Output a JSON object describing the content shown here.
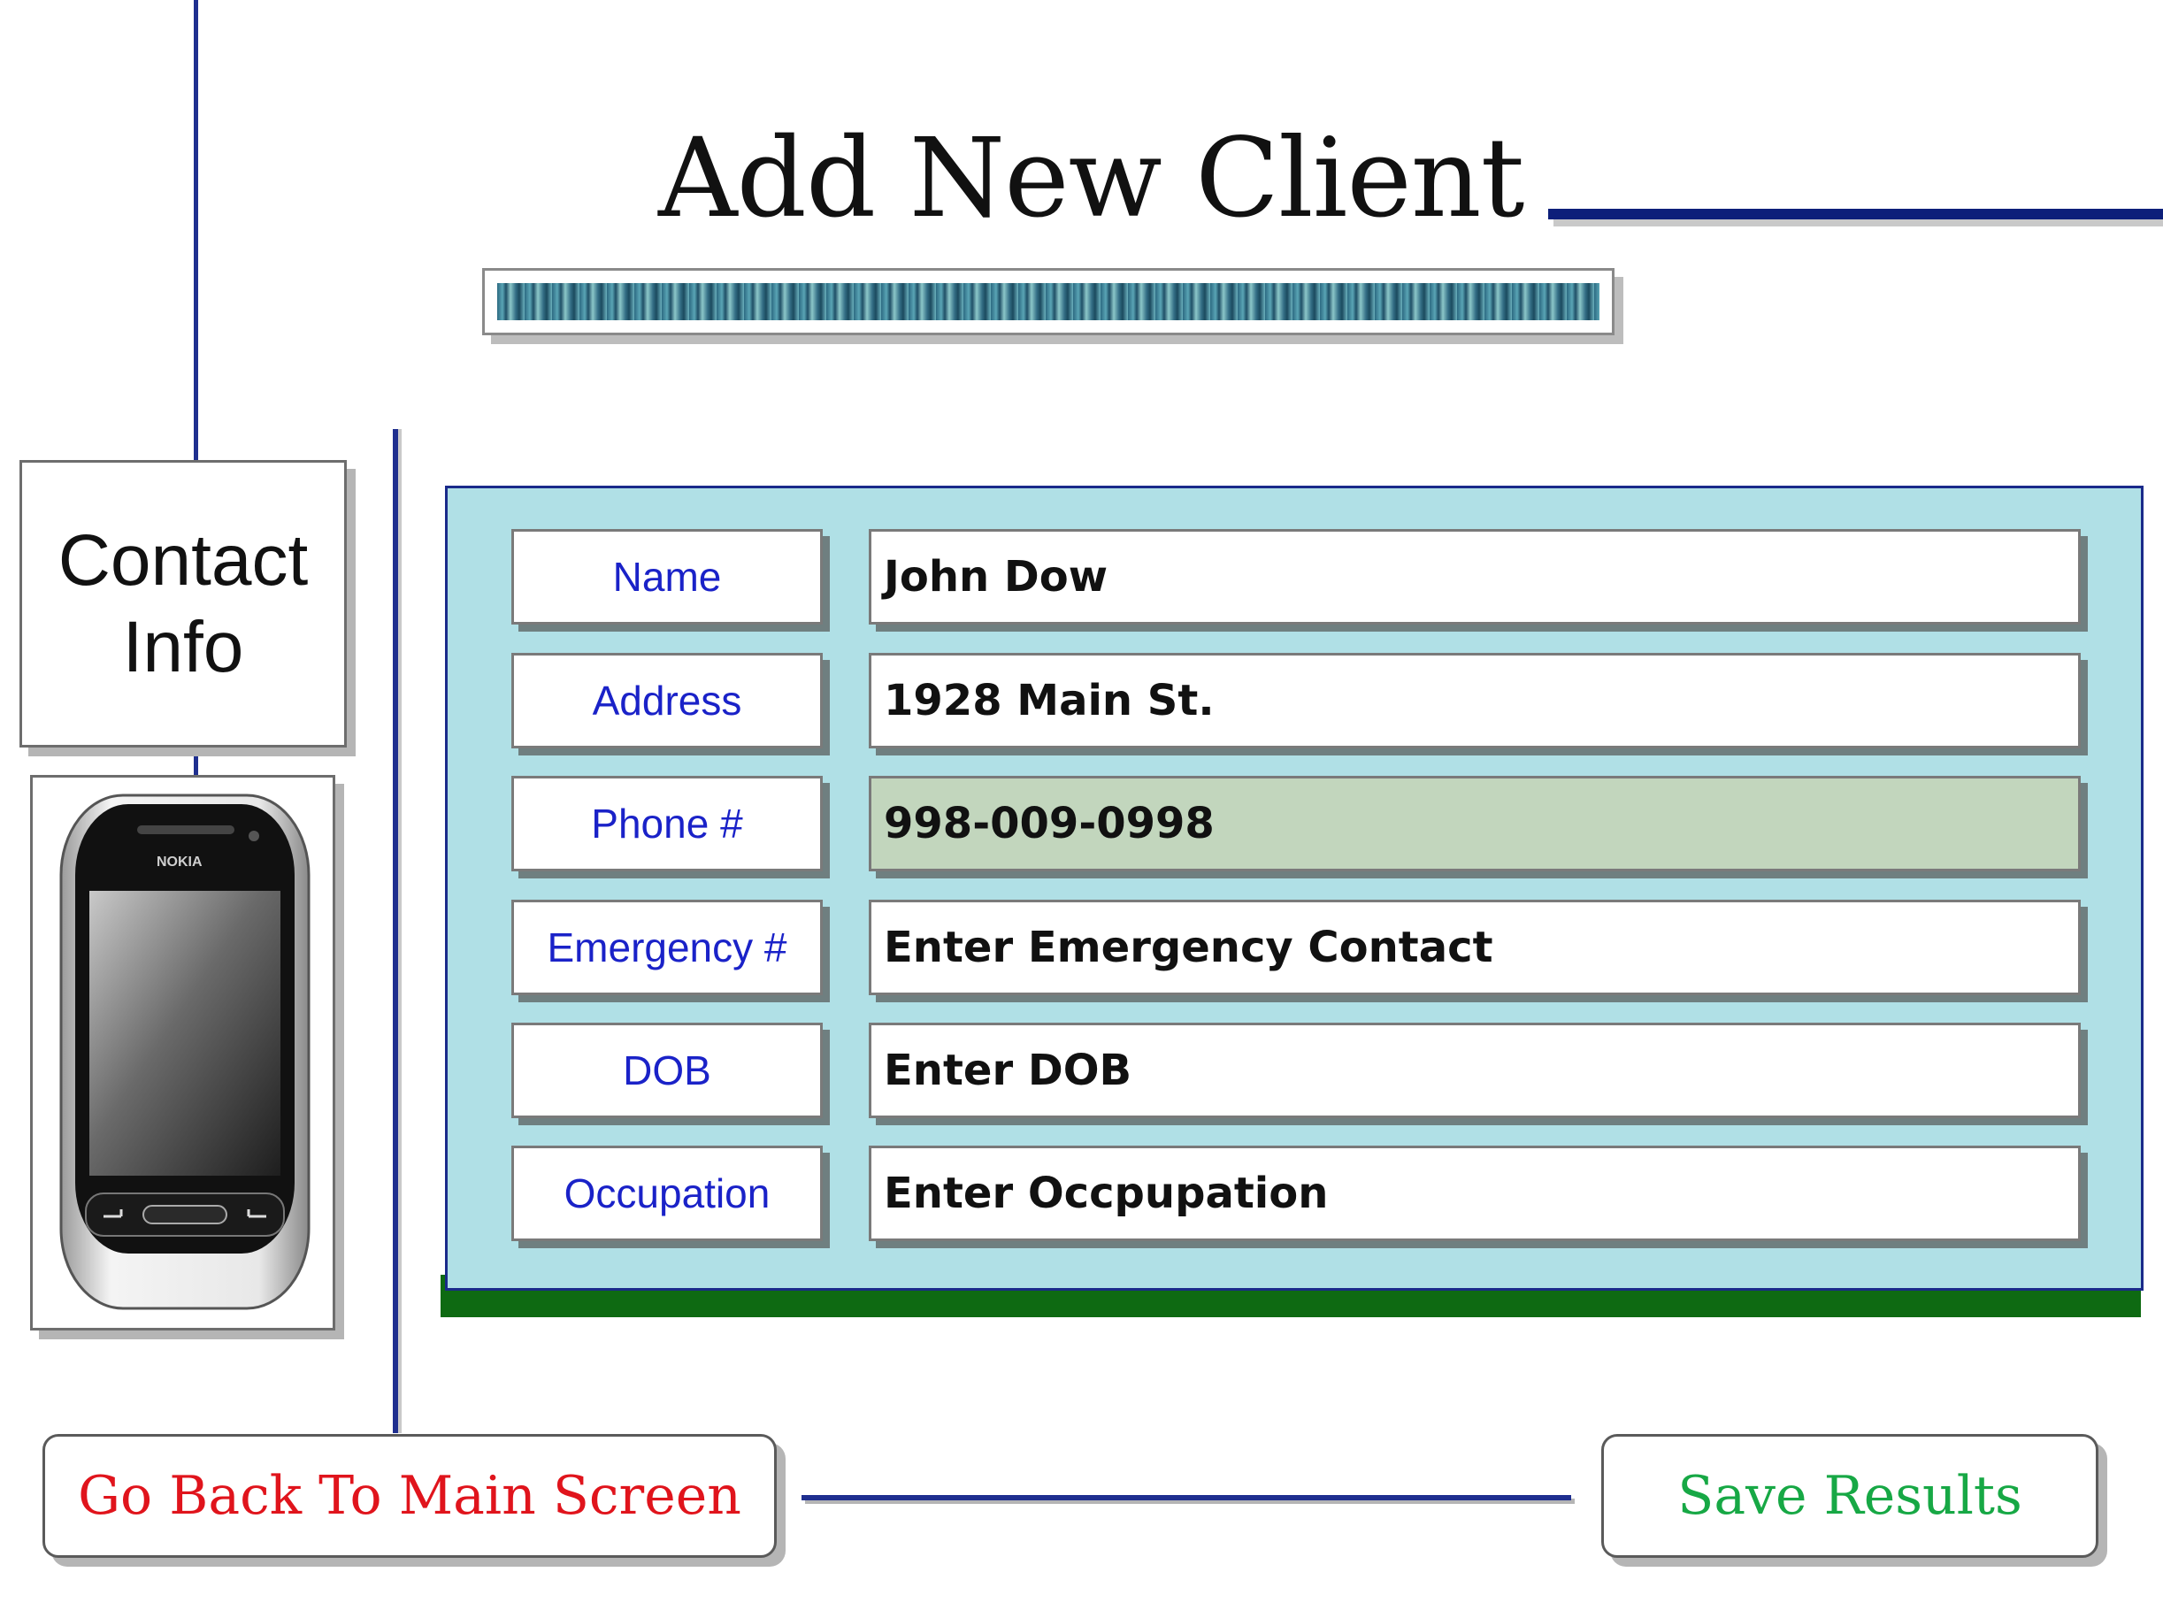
{
  "header": {
    "title": "Add New Client"
  },
  "sidebar": {
    "contact_info_label": "Contact\nInfo",
    "phone_brand_text": "NOKIA"
  },
  "form": {
    "fields": [
      {
        "label": "Name",
        "value": "John Dow"
      },
      {
        "label": "Address",
        "value": "1928 Main St."
      },
      {
        "label": "Phone #",
        "value": "998-009-0998"
      },
      {
        "label": "Emergency #",
        "value": "Enter Emergency Contact"
      },
      {
        "label": "DOB",
        "value": "Enter DOB"
      },
      {
        "label": "Occupation",
        "value": "Enter Occpupation"
      }
    ],
    "active_field_color": "#c2d6bd",
    "panel_color": "#b0e0e6",
    "label_text_color": "#1a22c8"
  },
  "buttons": {
    "go_back_label": "Go Back To Main Screen",
    "save_label": "Save Results",
    "go_back_color": "#e0141c",
    "save_color": "#17a845"
  }
}
